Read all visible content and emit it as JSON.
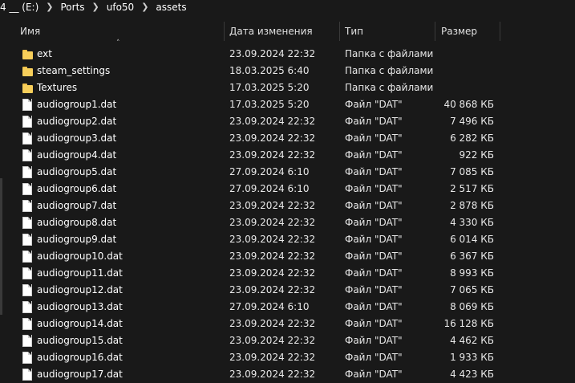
{
  "breadcrumb": [
    "4 __ (E:)",
    "Ports",
    "ufo50",
    "assets"
  ],
  "columns": {
    "name": "Имя",
    "date": "Дата изменения",
    "type": "Тип",
    "size": "Размер"
  },
  "colors": {
    "background": "#191919",
    "folder": "#f7ce5a",
    "text": "#ffffff"
  },
  "rows": [
    {
      "icon": "folder-icon",
      "name": "ext",
      "date": "23.09.2024 22:32",
      "type": "Папка с файлами",
      "size": ""
    },
    {
      "icon": "folder-icon",
      "name": "steam_settings",
      "date": "18.03.2025 6:40",
      "type": "Папка с файлами",
      "size": ""
    },
    {
      "icon": "folder-icon",
      "name": "Textures",
      "date": "17.03.2025 5:20",
      "type": "Папка с файлами",
      "size": ""
    },
    {
      "icon": "file-icon",
      "name": "audiogroup1.dat",
      "date": "17.03.2025 5:20",
      "type": "Файл \"DAT\"",
      "size": "40 868 КБ"
    },
    {
      "icon": "file-icon",
      "name": "audiogroup2.dat",
      "date": "23.09.2024 22:32",
      "type": "Файл \"DAT\"",
      "size": "7 496 КБ"
    },
    {
      "icon": "file-icon",
      "name": "audiogroup3.dat",
      "date": "23.09.2024 22:32",
      "type": "Файл \"DAT\"",
      "size": "6 282 КБ"
    },
    {
      "icon": "file-icon",
      "name": "audiogroup4.dat",
      "date": "23.09.2024 22:32",
      "type": "Файл \"DAT\"",
      "size": "922 КБ"
    },
    {
      "icon": "file-icon",
      "name": "audiogroup5.dat",
      "date": "27.09.2024 6:10",
      "type": "Файл \"DAT\"",
      "size": "7 085 КБ"
    },
    {
      "icon": "file-icon",
      "name": "audiogroup6.dat",
      "date": "27.09.2024 6:10",
      "type": "Файл \"DAT\"",
      "size": "2 517 КБ"
    },
    {
      "icon": "file-icon",
      "name": "audiogroup7.dat",
      "date": "23.09.2024 22:32",
      "type": "Файл \"DAT\"",
      "size": "2 878 КБ"
    },
    {
      "icon": "file-icon",
      "name": "audiogroup8.dat",
      "date": "23.09.2024 22:32",
      "type": "Файл \"DAT\"",
      "size": "4 330 КБ"
    },
    {
      "icon": "file-icon",
      "name": "audiogroup9.dat",
      "date": "23.09.2024 22:32",
      "type": "Файл \"DAT\"",
      "size": "6 014 КБ"
    },
    {
      "icon": "file-icon",
      "name": "audiogroup10.dat",
      "date": "23.09.2024 22:32",
      "type": "Файл \"DAT\"",
      "size": "6 367 КБ"
    },
    {
      "icon": "file-icon",
      "name": "audiogroup11.dat",
      "date": "23.09.2024 22:32",
      "type": "Файл \"DAT\"",
      "size": "8 993 КБ"
    },
    {
      "icon": "file-icon",
      "name": "audiogroup12.dat",
      "date": "23.09.2024 22:32",
      "type": "Файл \"DAT\"",
      "size": "7 065 КБ"
    },
    {
      "icon": "file-icon",
      "name": "audiogroup13.dat",
      "date": "27.09.2024 6:10",
      "type": "Файл \"DAT\"",
      "size": "8 069 КБ"
    },
    {
      "icon": "file-icon",
      "name": "audiogroup14.dat",
      "date": "23.09.2024 22:32",
      "type": "Файл \"DAT\"",
      "size": "16 128 КБ"
    },
    {
      "icon": "file-icon",
      "name": "audiogroup15.dat",
      "date": "23.09.2024 22:32",
      "type": "Файл \"DAT\"",
      "size": "4 462 КБ"
    },
    {
      "icon": "file-icon",
      "name": "audiogroup16.dat",
      "date": "23.09.2024 22:32",
      "type": "Файл \"DAT\"",
      "size": "1 933 КБ"
    },
    {
      "icon": "file-icon",
      "name": "audiogroup17.dat",
      "date": "23.09.2024 22:32",
      "type": "Файл \"DAT\"",
      "size": "4 423 КБ"
    }
  ]
}
